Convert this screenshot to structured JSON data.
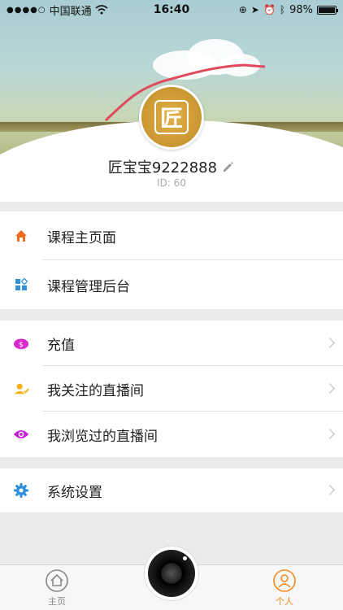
{
  "status_bar": {
    "carrier": "中国联通",
    "time": "16:40",
    "battery_percent": "98%",
    "battery_level": 0.98,
    "icons": [
      "signal-dots-icon",
      "wifi-icon",
      "orientation-lock-icon",
      "location-icon",
      "alarm-icon",
      "bluetooth-icon",
      "battery-icon"
    ]
  },
  "profile": {
    "avatar_char": "匠",
    "username": "匠宝宝9222888",
    "user_id": "ID: 60"
  },
  "menu": {
    "group1": [
      {
        "label": "课程主页面",
        "icon": "home-icon",
        "color": "#f06a1e"
      },
      {
        "label": "课程管理后台",
        "icon": "grid-icon",
        "color": "#2f8fd8"
      }
    ],
    "group2": [
      {
        "label": "充值",
        "icon": "money-bag-icon",
        "color": "#d92ad0"
      },
      {
        "label": "我关注的直播间",
        "icon": "follow-user-icon",
        "color": "#f5b21e"
      },
      {
        "label": "我浏览过的直播间",
        "icon": "eye-icon",
        "color": "#c21fd6"
      }
    ],
    "group3": [
      {
        "label": "系统设置",
        "icon": "gear-icon",
        "color": "#2f8fd8"
      }
    ]
  },
  "tabbar": {
    "home_label": "主页",
    "profile_label": "个人",
    "active_color": "#f08a1e",
    "inactive_color": "#888888"
  }
}
